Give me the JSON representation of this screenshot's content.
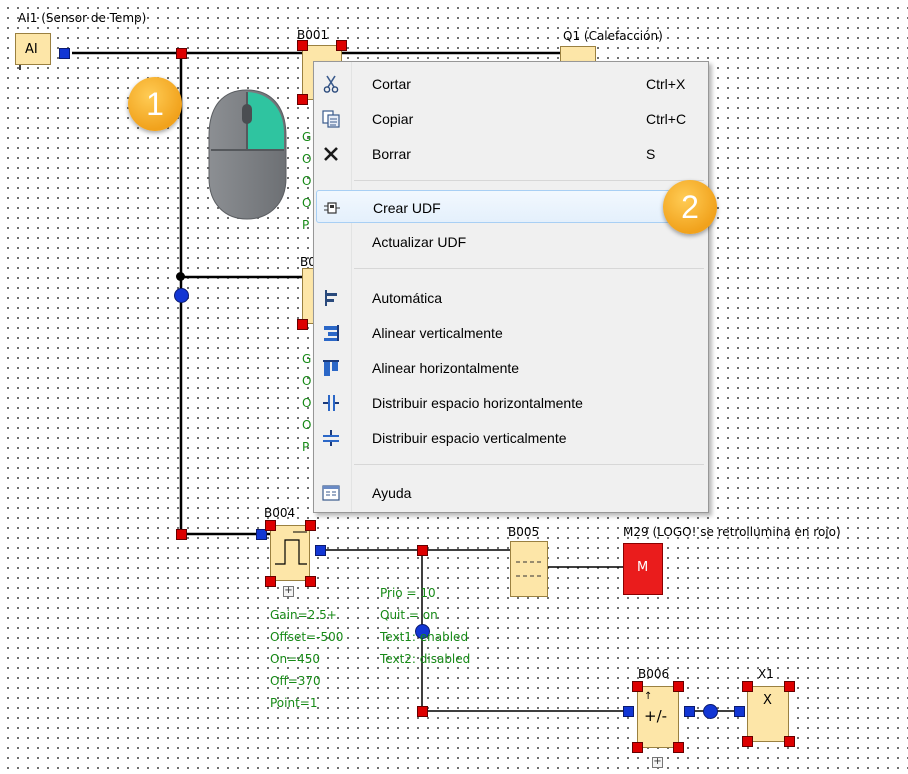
{
  "canvas": {
    "ai1_label": "AI1 (Sensor de Temp)",
    "ai_block_label": "AI",
    "b001_label": "B001",
    "b002_label": "B0",
    "q1_label": "Q1 (Calefacción)",
    "b004_label": "B004",
    "b005_label": "B005",
    "b006_label": "B006",
    "b006_symbol": "+/-",
    "m29_label": "M29 (LOGO! se retroilumina en rojo)",
    "m_block_label": "M",
    "x1_label": "X1",
    "x_block_label": "X",
    "b001_params": [
      "G",
      "O",
      "O",
      "O",
      "P"
    ],
    "b002_params": [
      "G",
      "O",
      "O",
      "O",
      "P"
    ],
    "b004_params": [
      "Gain=2.5+",
      "Offset=-500",
      "On=450",
      "Off=370",
      "Point=1"
    ],
    "b005_params": [
      "Prio = 10",
      "Quit = on",
      "Text1: enabled",
      "Text2: disabled"
    ]
  },
  "badges": {
    "step1": "1",
    "step2": "2"
  },
  "context_menu": {
    "items": [
      {
        "label": "Cortar",
        "shortcut": "Ctrl+X",
        "icon": "scissors-icon"
      },
      {
        "label": "Copiar",
        "shortcut": "Ctrl+C",
        "icon": "copy-icon"
      },
      {
        "label": "Borrar",
        "shortcut": "S",
        "icon": "delete-x-icon"
      },
      {
        "label": "Crear UDF",
        "shortcut": "",
        "icon": "udf-icon",
        "highlighted": true
      },
      {
        "label": "Actualizar  UDF",
        "shortcut": "",
        "icon": ""
      },
      {
        "label": "Automática",
        "shortcut": "",
        "icon": "auto-align-icon"
      },
      {
        "label": "Alinear verticalmente",
        "shortcut": "",
        "icon": "align-vertical-icon"
      },
      {
        "label": "Alinear horizontalmente",
        "shortcut": "",
        "icon": "align-horizontal-icon"
      },
      {
        "label": "Distribuir espacio horizontalmente",
        "shortcut": "",
        "icon": "distribute-horizontal-icon"
      },
      {
        "label": "Distribuir espacio verticalmente",
        "shortcut": "",
        "icon": "distribute-vertical-icon"
      },
      {
        "label": "Ayuda",
        "shortcut": "",
        "icon": "help-icon"
      }
    ]
  },
  "colors": {
    "menu_highlight": "#e4f0fc",
    "badge": "#f1a21c",
    "mouse_button": "#2fc4a0",
    "connector_red": "#dd0000",
    "connector_blue": "#1236d4",
    "block_fill": "#fde6a8"
  }
}
